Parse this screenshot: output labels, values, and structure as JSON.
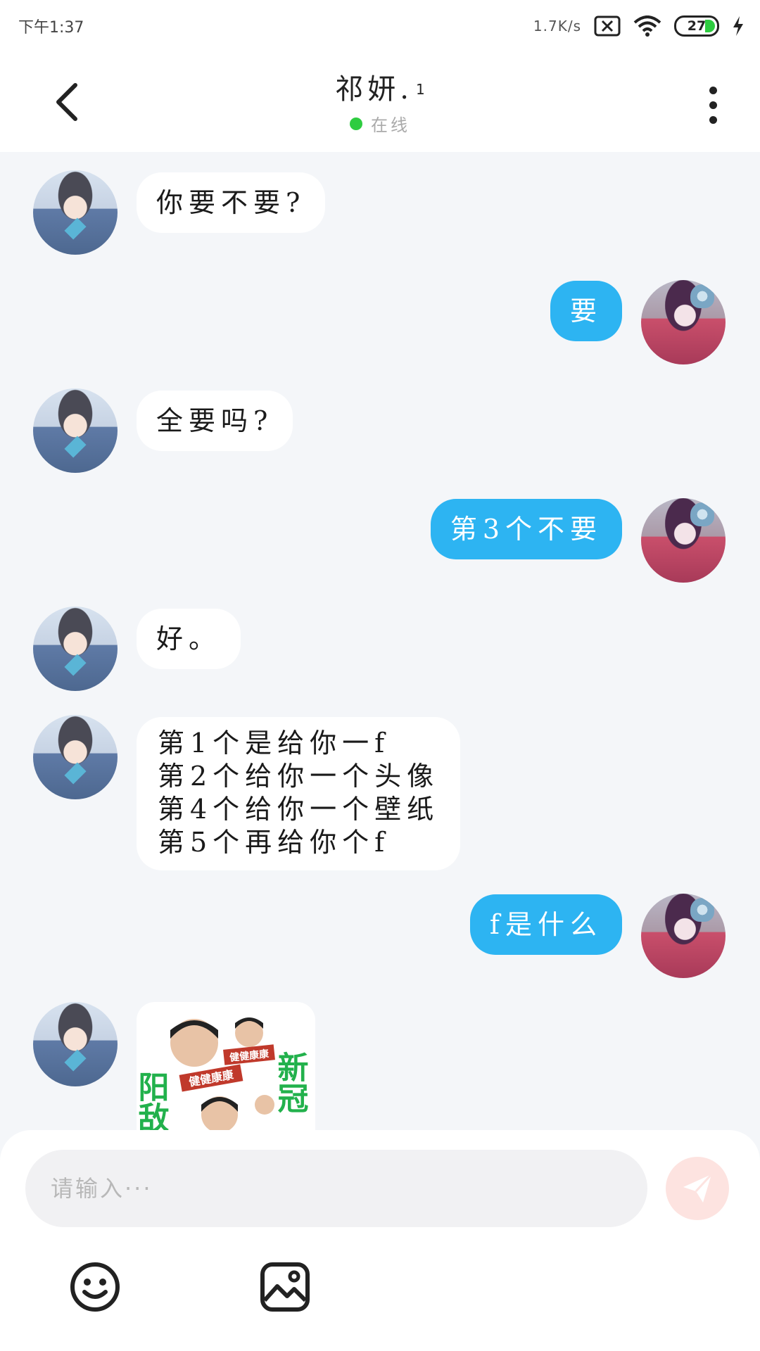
{
  "status_bar": {
    "time": "下午1:37",
    "net_speed": "1.7K/s",
    "battery": "27"
  },
  "header": {
    "contact_name": "祁妍.",
    "name_sup": "1",
    "presence": "在线"
  },
  "messages": [
    {
      "side": "in",
      "text": "你要不要?"
    },
    {
      "side": "out",
      "text": "要"
    },
    {
      "side": "in",
      "text": "全要吗?"
    },
    {
      "side": "out",
      "text": "第3个不要"
    },
    {
      "side": "in",
      "text": "好。"
    },
    {
      "side": "in",
      "text": "第1个是给你一f\n第2个给你一个头像\n第4个给你一个壁纸\n第5个再给你个f"
    },
    {
      "side": "out",
      "text": "f是什么"
    },
    {
      "side": "in",
      "type": "sticker"
    }
  ],
  "sticker": {
    "left_text": "阳敌",
    "right_text": "新冠",
    "badge_text": "健健康康"
  },
  "input": {
    "placeholder": "请输入···",
    "value": ""
  },
  "icons": {
    "back": "chevron-left-icon",
    "more": "more-vertical-icon",
    "send": "send-icon",
    "emoji": "emoji-icon",
    "image": "image-icon"
  },
  "colors": {
    "outgoing_bubble": "#2db4f2",
    "online_dot": "#2ecc40",
    "send_button": "#fde3e0"
  }
}
